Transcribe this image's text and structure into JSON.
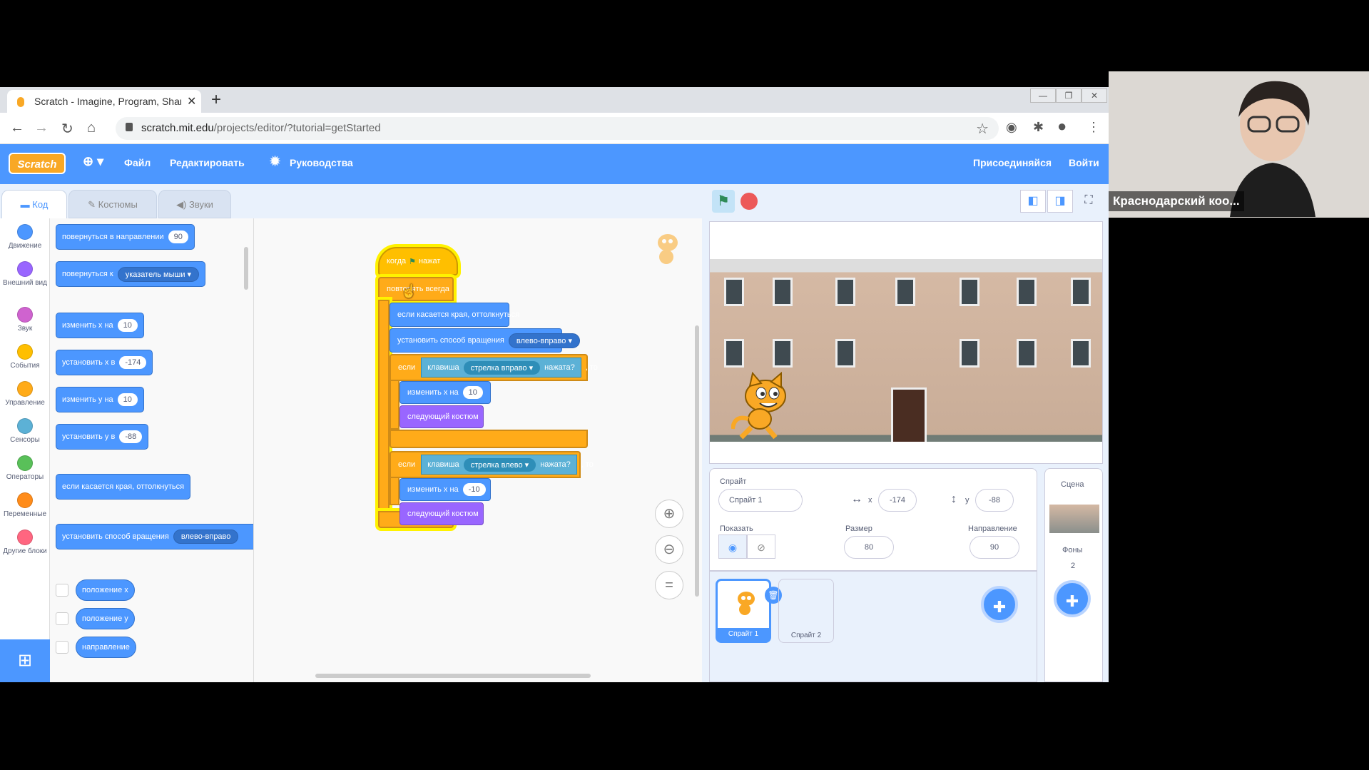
{
  "browser": {
    "tab_title": "Scratch - Imagine, Program, Shar",
    "url_host": "scratch.mit.edu",
    "url_path": "/projects/editor/?tutorial=getStarted"
  },
  "menubar": {
    "logo": "Scratch",
    "file": "Файл",
    "edit": "Редактировать",
    "tutorials": "Руководства",
    "join": "Присоединяйся",
    "signin": "Войти"
  },
  "editor_tabs": {
    "code": "Код",
    "costumes": "Костюмы",
    "sounds": "Звуки"
  },
  "categories": [
    {
      "label": "Движение",
      "color": "#4c97ff"
    },
    {
      "label": "Внешний вид",
      "color": "#9966ff"
    },
    {
      "label": "Звук",
      "color": "#cf63cf"
    },
    {
      "label": "События",
      "color": "#ffbf00"
    },
    {
      "label": "Управление",
      "color": "#ffab19"
    },
    {
      "label": "Сенсоры",
      "color": "#5cb1d6"
    },
    {
      "label": "Операторы",
      "color": "#59c059"
    },
    {
      "label": "Переменные",
      "color": "#ff8c1a"
    },
    {
      "label": "Другие блоки",
      "color": "#ff6680"
    }
  ],
  "palette": {
    "point_direction": "повернуться в направлении",
    "point_direction_val": "90",
    "point_towards": "повернуться к",
    "point_towards_val": "указатель мыши",
    "change_x": "изменить х на",
    "change_x_val": "10",
    "set_x": "установить х в",
    "set_x_val": "-174",
    "change_y": "изменить у на",
    "change_y_val": "10",
    "set_y": "установить у в",
    "set_y_val": "-88",
    "bounce": "если касается края, оттолкнуться",
    "rotation_style": "установить способ вращения",
    "rotation_style_val": "влево-вправо",
    "x_position": "положение х",
    "y_position": "положение у",
    "direction": "направление"
  },
  "script": {
    "when_flag": "когда",
    "clicked": "нажат",
    "forever": "повторять всегда",
    "bounce": "если касается края, оттолкнуться",
    "rotation_style": "установить способ вращения",
    "rotation_style_val": "влево-вправо",
    "if1": "если",
    "key1": "клавиша",
    "key1_val": "стрелка вправо",
    "pressed1": "нажата?",
    "then1": ", то",
    "change_x1": "изменить х на",
    "change_x1_val": "10",
    "next_costume1": "следующий костюм",
    "if2": "если",
    "key2": "клавиша",
    "key2_val": "стрелка влево",
    "pressed2": "нажата?",
    "then2": ", то",
    "change_x2": "изменить х на",
    "change_x2_val": "-10",
    "next_costume2": "следующий костюм"
  },
  "sprite_info": {
    "sprite_label": "Спрайт",
    "sprite_name": "Спрайт 1",
    "x_label": "x",
    "x_val": "-174",
    "y_label": "y",
    "y_val": "-88",
    "show_label": "Показать",
    "size_label": "Размер",
    "size_val": "80",
    "direction_label": "Направление",
    "direction_val": "90"
  },
  "sprites": [
    {
      "name": "Спрайт 1",
      "selected": true
    },
    {
      "name": "Спрайт 2",
      "selected": false
    }
  ],
  "scene": {
    "title": "Сцена",
    "backdrops_label": "Фоны",
    "backdrops_count": "2"
  },
  "video": {
    "name": "Краснодарский коо..."
  },
  "colors": {
    "scratch_blue": "#4c97ff",
    "events": "#ffbf00",
    "control": "#ffab19",
    "looks": "#9966ff",
    "sensing": "#5cb1d6"
  }
}
